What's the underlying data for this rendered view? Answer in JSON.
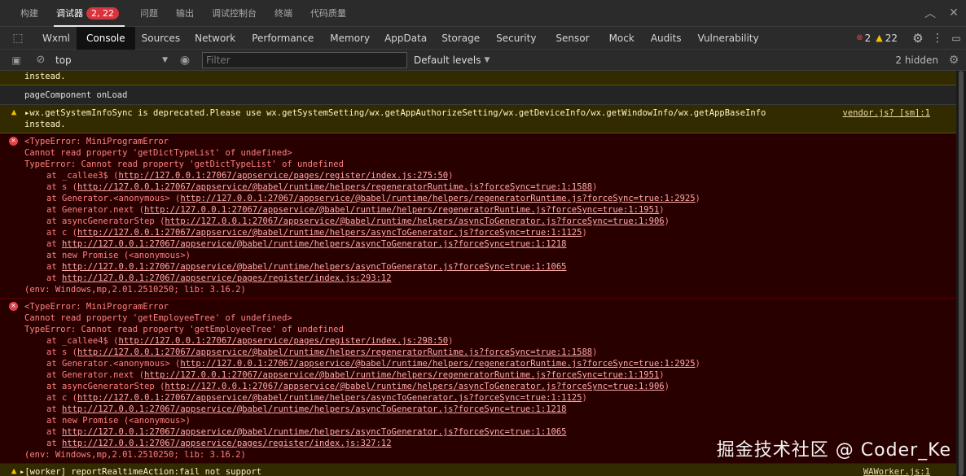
{
  "top_tabs": [
    {
      "label": "构建",
      "active": false
    },
    {
      "label": "调试器",
      "active": true,
      "badge": "2, 22"
    },
    {
      "label": "问题",
      "active": false
    },
    {
      "label": "输出",
      "active": false
    },
    {
      "label": "调试控制台",
      "active": false
    },
    {
      "label": "终端",
      "active": false
    },
    {
      "label": "代码质量",
      "active": false
    }
  ],
  "panel_tabs": [
    "Wxml",
    "Console",
    "Sources",
    "Network",
    "Performance",
    "Memory",
    "AppData",
    "Storage",
    "Security",
    "Sensor",
    "Mock",
    "Audits",
    "Vulnerability"
  ],
  "active_panel": "Console",
  "counts": {
    "errors": "2",
    "warnings": "22"
  },
  "toolbar": {
    "context": "top",
    "filter_placeholder": "Filter",
    "levels": "Default levels",
    "hidden": "2 hidden"
  },
  "messages": {
    "m0": "instead.",
    "m1": "pageComponent onLoad",
    "m2": "▸wx.getSystemInfoSync is deprecated.Please use wx.getSystemSetting/wx.getAppAuthorizeSetting/wx.getDeviceInfo/wx.getWindowInfo/wx.getAppBaseInfo",
    "m2b": "instead.",
    "m2src": "vendor.js? [sm]:1",
    "e1": {
      "l1": "<TypeError: MiniProgramError",
      "l2": "Cannot read property 'getDictTypeList' of undefined>",
      "l3": "TypeError: Cannot read property 'getDictTypeList' of undefined",
      "s1a": "at _callee3$ (",
      "s1b": "http://127.0.0.1:27067/appservice/pages/register/index.js:275:50",
      "s1c": ")",
      "s2a": "at s (",
      "s2b": "http://127.0.0.1:27067/appservice/@babel/runtime/helpers/regeneratorRuntime.js?forceSync=true:1:1588",
      "s2c": ")",
      "s3a": "at Generator.<anonymous> (",
      "s3b": "http://127.0.0.1:27067/appservice/@babel/runtime/helpers/regeneratorRuntime.js?forceSync=true:1:2925",
      "s3c": ")",
      "s4a": "at Generator.next (",
      "s4b": "http://127.0.0.1:27067/appservice/@babel/runtime/helpers/regeneratorRuntime.js?forceSync=true:1:1951",
      "s4c": ")",
      "s5a": "at asyncGeneratorStep (",
      "s5b": "http://127.0.0.1:27067/appservice/@babel/runtime/helpers/asyncToGenerator.js?forceSync=true:1:906",
      "s5c": ")",
      "s6a": "at c (",
      "s6b": "http://127.0.0.1:27067/appservice/@babel/runtime/helpers/asyncToGenerator.js?forceSync=true:1:1125",
      "s6c": ")",
      "s7a": "at ",
      "s7b": "http://127.0.0.1:27067/appservice/@babel/runtime/helpers/asyncToGenerator.js?forceSync=true:1:1218",
      "s8": "at new Promise (<anonymous>)",
      "s9a": "at ",
      "s9b": "http://127.0.0.1:27067/appservice/@babel/runtime/helpers/asyncToGenerator.js?forceSync=true:1:1065",
      "s10a": "at ",
      "s10b": "http://127.0.0.1:27067/appservice/pages/register/index.js:293:12",
      "env": "(env: Windows,mp,2.01.2510250; lib: 3.16.2)"
    },
    "e2": {
      "l1": "<TypeError: MiniProgramError",
      "l2": "Cannot read property 'getEmployeeTree' of undefined>",
      "l3": "TypeError: Cannot read property 'getEmployeeTree' of undefined",
      "s1a": "at _callee4$ (",
      "s1b": "http://127.0.0.1:27067/appservice/pages/register/index.js:298:50",
      "s1c": ")",
      "s2a": "at s (",
      "s2b": "http://127.0.0.1:27067/appservice/@babel/runtime/helpers/regeneratorRuntime.js?forceSync=true:1:1588",
      "s2c": ")",
      "s3a": "at Generator.<anonymous> (",
      "s3b": "http://127.0.0.1:27067/appservice/@babel/runtime/helpers/regeneratorRuntime.js?forceSync=true:1:2925",
      "s3c": ")",
      "s4a": "at Generator.next (",
      "s4b": "http://127.0.0.1:27067/appservice/@babel/runtime/helpers/regeneratorRuntime.js?forceSync=true:1:1951",
      "s4c": ")",
      "s5a": "at asyncGeneratorStep (",
      "s5b": "http://127.0.0.1:27067/appservice/@babel/runtime/helpers/asyncToGenerator.js?forceSync=true:1:906",
      "s5c": ")",
      "s6a": "at c (",
      "s6b": "http://127.0.0.1:27067/appservice/@babel/runtime/helpers/asyncToGenerator.js?forceSync=true:1:1125",
      "s6c": ")",
      "s7a": "at ",
      "s7b": "http://127.0.0.1:27067/appservice/@babel/runtime/helpers/asyncToGenerator.js?forceSync=true:1:1218",
      "s8": "at new Promise (<anonymous>)",
      "s9a": "at ",
      "s9b": "http://127.0.0.1:27067/appservice/@babel/runtime/helpers/asyncToGenerator.js?forceSync=true:1:1065",
      "s10a": "at ",
      "s10b": "http://127.0.0.1:27067/appservice/pages/register/index.js:327:12",
      "env": "(env: Windows,mp,2.01.2510250; lib: 3.16.2)"
    },
    "w_last": "▸[worker] reportRealtimeAction:fail not support",
    "w_last_src": "WAWorker.js:1"
  },
  "watermark": "掘金技术社区 @ Coder_Ke",
  "colors": {
    "warn_bg": "#332b00",
    "error_bg": "#290000",
    "error_text": "#ff8080",
    "badge": "#d9343d"
  }
}
